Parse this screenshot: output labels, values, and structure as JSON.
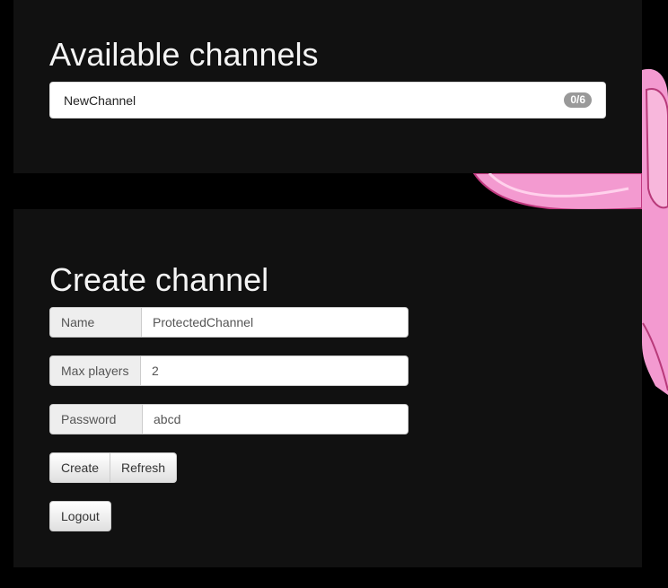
{
  "available": {
    "title": "Available channels",
    "channels": [
      {
        "name": "NewChannel",
        "count": "0/6"
      }
    ]
  },
  "create": {
    "title": "Create channel",
    "name_label": "Name",
    "name_value": "ProtectedChannel",
    "max_players_label": "Max players",
    "max_players_value": "2",
    "password_label": "Password",
    "password_value": "abcd",
    "create_button": "Create",
    "refresh_button": "Refresh",
    "logout_button": "Logout"
  },
  "colors": {
    "background": "#000000",
    "panel": "#111111",
    "accent_pink": "#f08cc6"
  },
  "icons": [
    "decorative-pink-ribbon-art"
  ]
}
